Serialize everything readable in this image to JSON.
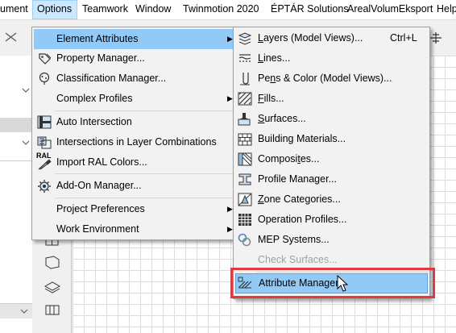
{
  "menubar": {
    "items": [
      {
        "label": "ument"
      },
      {
        "label": "Options"
      },
      {
        "label": "Teamwork"
      },
      {
        "label": "Window"
      },
      {
        "label": "Twinmotion 2020"
      },
      {
        "label": "ÉPTÁR Solutions"
      },
      {
        "label": "ArealVolumEksport"
      },
      {
        "label": "Help"
      }
    ]
  },
  "options_menu": {
    "items": [
      {
        "label": "Element Attributes",
        "icon": "none",
        "submenu": true
      },
      {
        "label": "Property Manager...",
        "icon": "tag-icon"
      },
      {
        "label": "Classification Manager...",
        "icon": "tree-icon"
      },
      {
        "label": "Complex Profiles",
        "icon": "none",
        "submenu": true
      },
      {
        "label": "Auto Intersection",
        "icon": "intersection-icon"
      },
      {
        "label": "Intersections in Layer Combinations",
        "icon": "layer-intersection-icon"
      },
      {
        "label": "Import RAL Colors...",
        "icon": "ral-icon",
        "icon_text": "RAL"
      },
      {
        "label": "Add-On Manager...",
        "icon": "gear-addon-icon"
      },
      {
        "label": "Project Preferences",
        "icon": "none",
        "submenu": true
      },
      {
        "label": "Work Environment",
        "icon": "none",
        "submenu": true
      }
    ]
  },
  "element_attributes_menu": {
    "items": [
      {
        "label_u": "L",
        "label_rest": "ayers (Model Views)...",
        "shortcut": "Ctrl+L",
        "icon": "layers-icon"
      },
      {
        "label_u": "L",
        "label_rest": "ines...",
        "icon": "lines-icon"
      },
      {
        "label_pre": "Pe",
        "label_u": "n",
        "label_rest": "s & Color (Model Views)...",
        "icon": "pen-icon"
      },
      {
        "label_u": "F",
        "label_rest": "ills...",
        "icon": "fill-icon"
      },
      {
        "label_u": "S",
        "label_rest": "urfaces...",
        "icon": "surface-brush-icon"
      },
      {
        "label_pre": "",
        "label_u": "",
        "label_rest": "Building Materials...",
        "icon": "building-materials-icon"
      },
      {
        "label_pre": "Composi",
        "label_u": "t",
        "label_rest": "es...",
        "icon": "composites-icon"
      },
      {
        "label_pre": "",
        "label_u": "",
        "label_rest": "Profile Manager...",
        "icon": "profile-icon"
      },
      {
        "label_u": "Z",
        "label_rest": "one Categories...",
        "icon": "zone-icon"
      },
      {
        "label_pre": "",
        "label_u": "",
        "label_rest": "Operation Profiles...",
        "icon": "operation-grid-icon"
      },
      {
        "label_pre": "",
        "label_u": "",
        "label_rest": "MEP Systems...",
        "icon": "mep-icon"
      },
      {
        "label_pre": "",
        "label_u": "",
        "label_rest": "Check Surfaces...",
        "icon": "none",
        "disabled": true
      },
      {
        "label_pre": "",
        "label_u": "",
        "label_rest": "Attribute Manager",
        "icon": "attribute-manager-icon",
        "highlighted": true
      }
    ]
  },
  "colors": {
    "highlight": "#91c9f7",
    "menubar_active": "#cce8ff",
    "callout_border": "#e0393e",
    "disabled_text": "#a0a0a0"
  }
}
